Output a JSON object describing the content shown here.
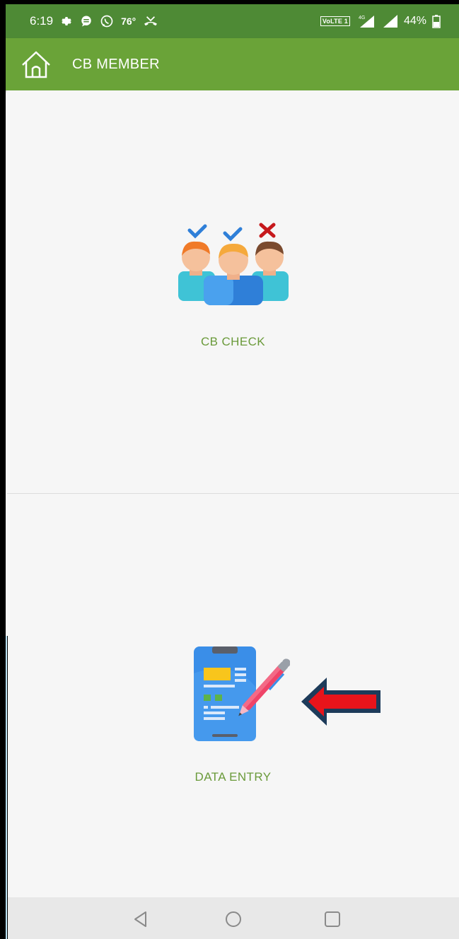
{
  "status_bar": {
    "time": "6:19",
    "temperature": "76°",
    "network_badge": "VoLTE 1",
    "network_type": "4G",
    "battery": "44%",
    "icons": [
      "settings-icon",
      "message-icon",
      "whatsapp-icon",
      "missed-call-icon",
      "signal-icon",
      "signal-icon",
      "battery-icon"
    ]
  },
  "app_bar": {
    "title": "CB MEMBER",
    "home_icon": "home-icon"
  },
  "menu": {
    "items": [
      {
        "label": "CB CHECK",
        "icon": "people-check-icon"
      },
      {
        "label": "DATA ENTRY",
        "icon": "form-pen-icon"
      }
    ]
  },
  "annotation": {
    "arrow_color": "#e8141b",
    "arrow_outline": "#1d3b5a"
  },
  "nav_bar": {
    "buttons": [
      "back-icon",
      "home-circle-icon",
      "recents-icon"
    ]
  },
  "colors": {
    "status_bar": "#4e8a35",
    "app_bar": "#6aa338",
    "label_green": "#6a9a3a"
  }
}
